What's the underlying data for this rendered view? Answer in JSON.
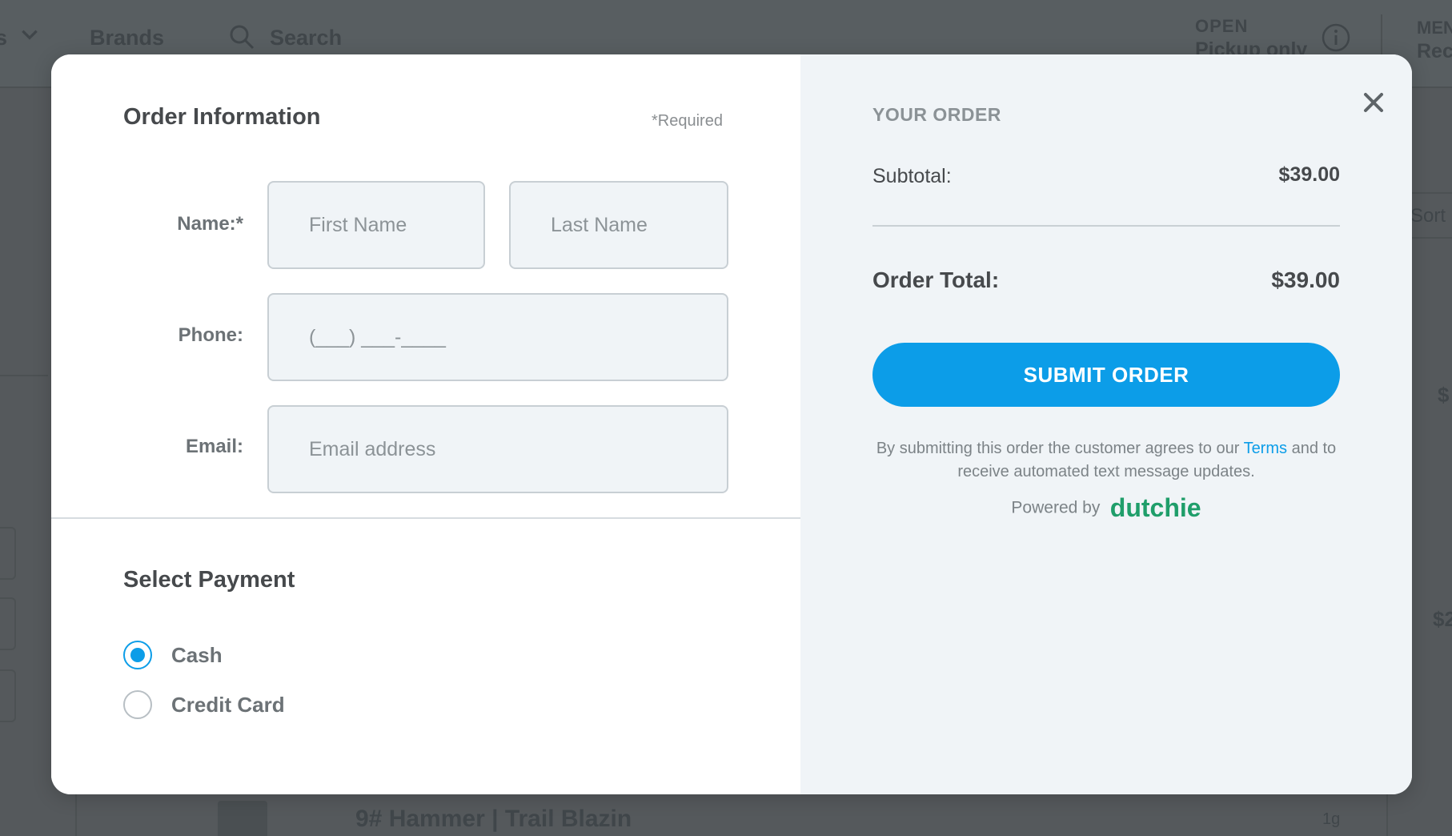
{
  "background": {
    "nav": {
      "categories_label": "s",
      "brands_label": "Brands",
      "search_label": "Search",
      "store_status": "OPEN",
      "store_mode": "Pickup only",
      "menu_label": "MEN",
      "menu_type": "Rec"
    },
    "sort_label": "Sort",
    "price_partial_1": "$",
    "price_partial_2": "$2",
    "product": {
      "name": "9# Hammer | Trail Blazin",
      "size": "1g"
    }
  },
  "modal": {
    "order_info": {
      "title": "Order Information",
      "required_note": "*Required",
      "name_label": "Name:*",
      "first_name_placeholder": "First Name",
      "last_name_placeholder": "Last Name",
      "phone_label": "Phone:",
      "phone_placeholder": "(___) ___-____",
      "email_label": "Email:",
      "email_placeholder": "Email address"
    },
    "payment": {
      "title": "Select Payment",
      "options": [
        {
          "label": "Cash",
          "selected": true
        },
        {
          "label": "Credit Card",
          "selected": false
        }
      ]
    },
    "summary": {
      "title": "YOUR ORDER",
      "subtotal_label": "Subtotal:",
      "subtotal_value": "$39.00",
      "total_label": "Order Total:",
      "total_value": "$39.00",
      "submit_label": "SUBMIT ORDER",
      "terms_before": "By submitting this order the customer agrees to our ",
      "terms_link": "Terms",
      "terms_after": " and to receive automated text message updates.",
      "powered_by": "Powered by",
      "brand": "dutchie"
    },
    "close_icon": "close-icon"
  },
  "colors": {
    "accent": "#0c9de8",
    "brand_green": "#1f9e6a",
    "overlay": "#55595c",
    "summary_bg": "#f0f4f7"
  }
}
